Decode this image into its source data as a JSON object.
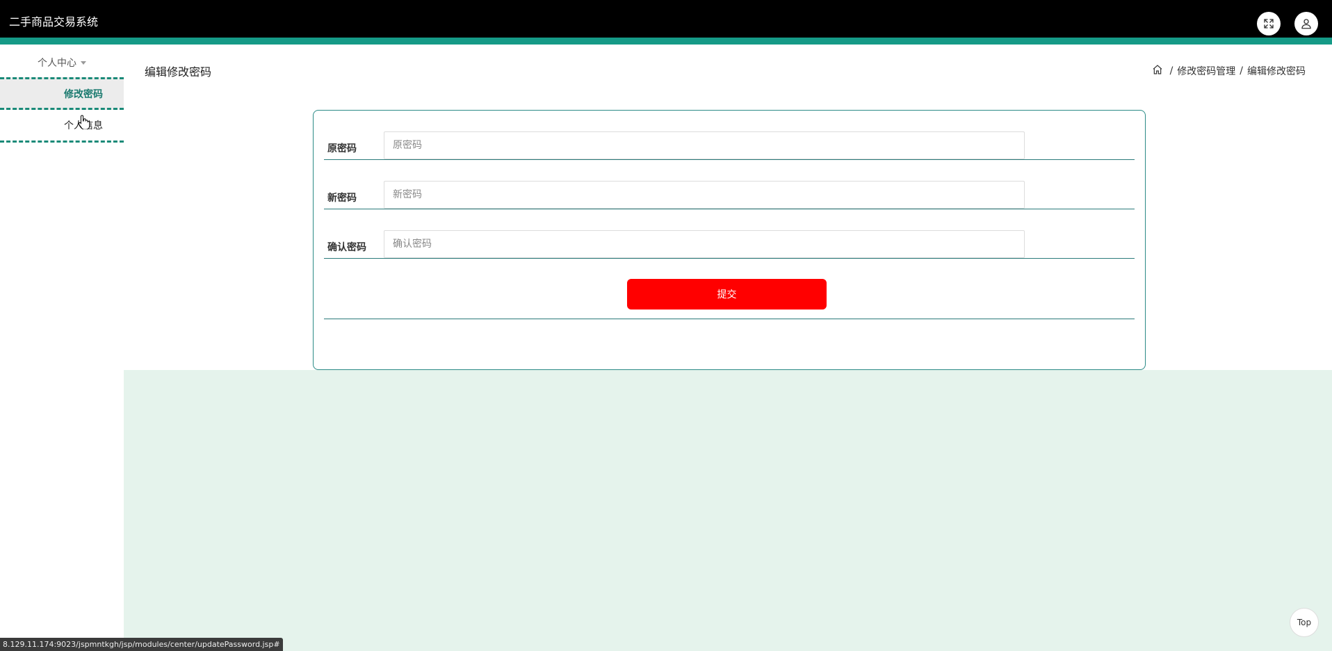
{
  "header": {
    "app_title": "二手商品交易系统",
    "fullscreen_icon": "fullscreen-icon",
    "user_icon": "user-icon"
  },
  "sidebar": {
    "group_label": "个人中心",
    "items": [
      {
        "label": "修改密码",
        "active": true
      },
      {
        "label": "个人信息",
        "active": false
      }
    ]
  },
  "page": {
    "title": "编辑修改密码",
    "breadcrumb": [
      "修改密码管理",
      "编辑修改密码"
    ]
  },
  "form": {
    "fields": [
      {
        "label": "原密码",
        "placeholder": "原密码",
        "value": ""
      },
      {
        "label": "新密码",
        "placeholder": "新密码",
        "value": ""
      },
      {
        "label": "确认密码",
        "placeholder": "确认密码",
        "value": ""
      }
    ],
    "submit_label": "提交"
  },
  "back_to_top_label": "Top",
  "status_url": "8.129.11.174:9023/jspmntkgh/jsp/modules/center/updatePassword.jsp#",
  "colors": {
    "header_bg": "#000000",
    "accent": "#159a87",
    "submit": "#ff0000",
    "content_bg": "#e5f3ec"
  }
}
